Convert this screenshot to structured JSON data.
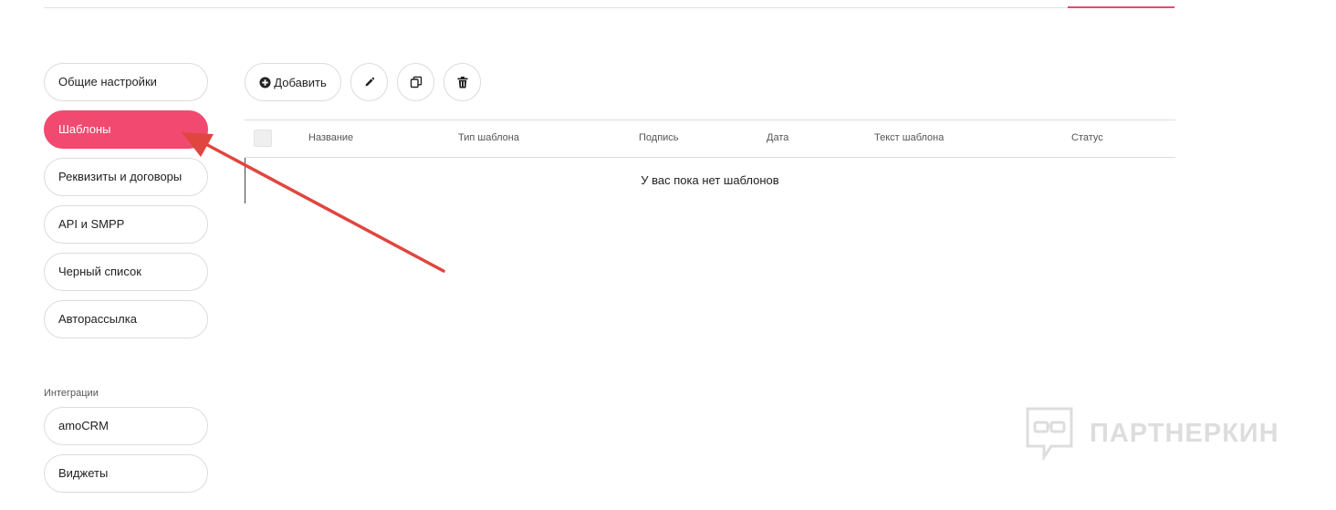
{
  "sidebar": {
    "items": [
      {
        "label": "Общие настройки"
      },
      {
        "label": "Шаблоны"
      },
      {
        "label": "Реквизиты и договоры"
      },
      {
        "label": "API и SMPP"
      },
      {
        "label": "Черный список"
      },
      {
        "label": "Авторассылка"
      }
    ],
    "integrations_label": "Интеграции",
    "integrations": [
      {
        "label": "amoCRM"
      },
      {
        "label": "Виджеты"
      }
    ]
  },
  "toolbar": {
    "add_label": "Добавить",
    "add_icon": "plus-circle-icon",
    "edit_icon": "pencil-icon",
    "copy_icon": "copy-icon",
    "delete_icon": "trash-icon"
  },
  "table": {
    "columns": [
      "Название",
      "Тип шаблона",
      "Подпись",
      "Дата",
      "Текст шаблона",
      "Статус"
    ],
    "empty_message": "У вас пока нет шаблонов"
  },
  "watermark": {
    "text": "ПАРТНЕРКИН"
  },
  "colors": {
    "accent": "#f1496f",
    "arrow": "#e0463f"
  }
}
